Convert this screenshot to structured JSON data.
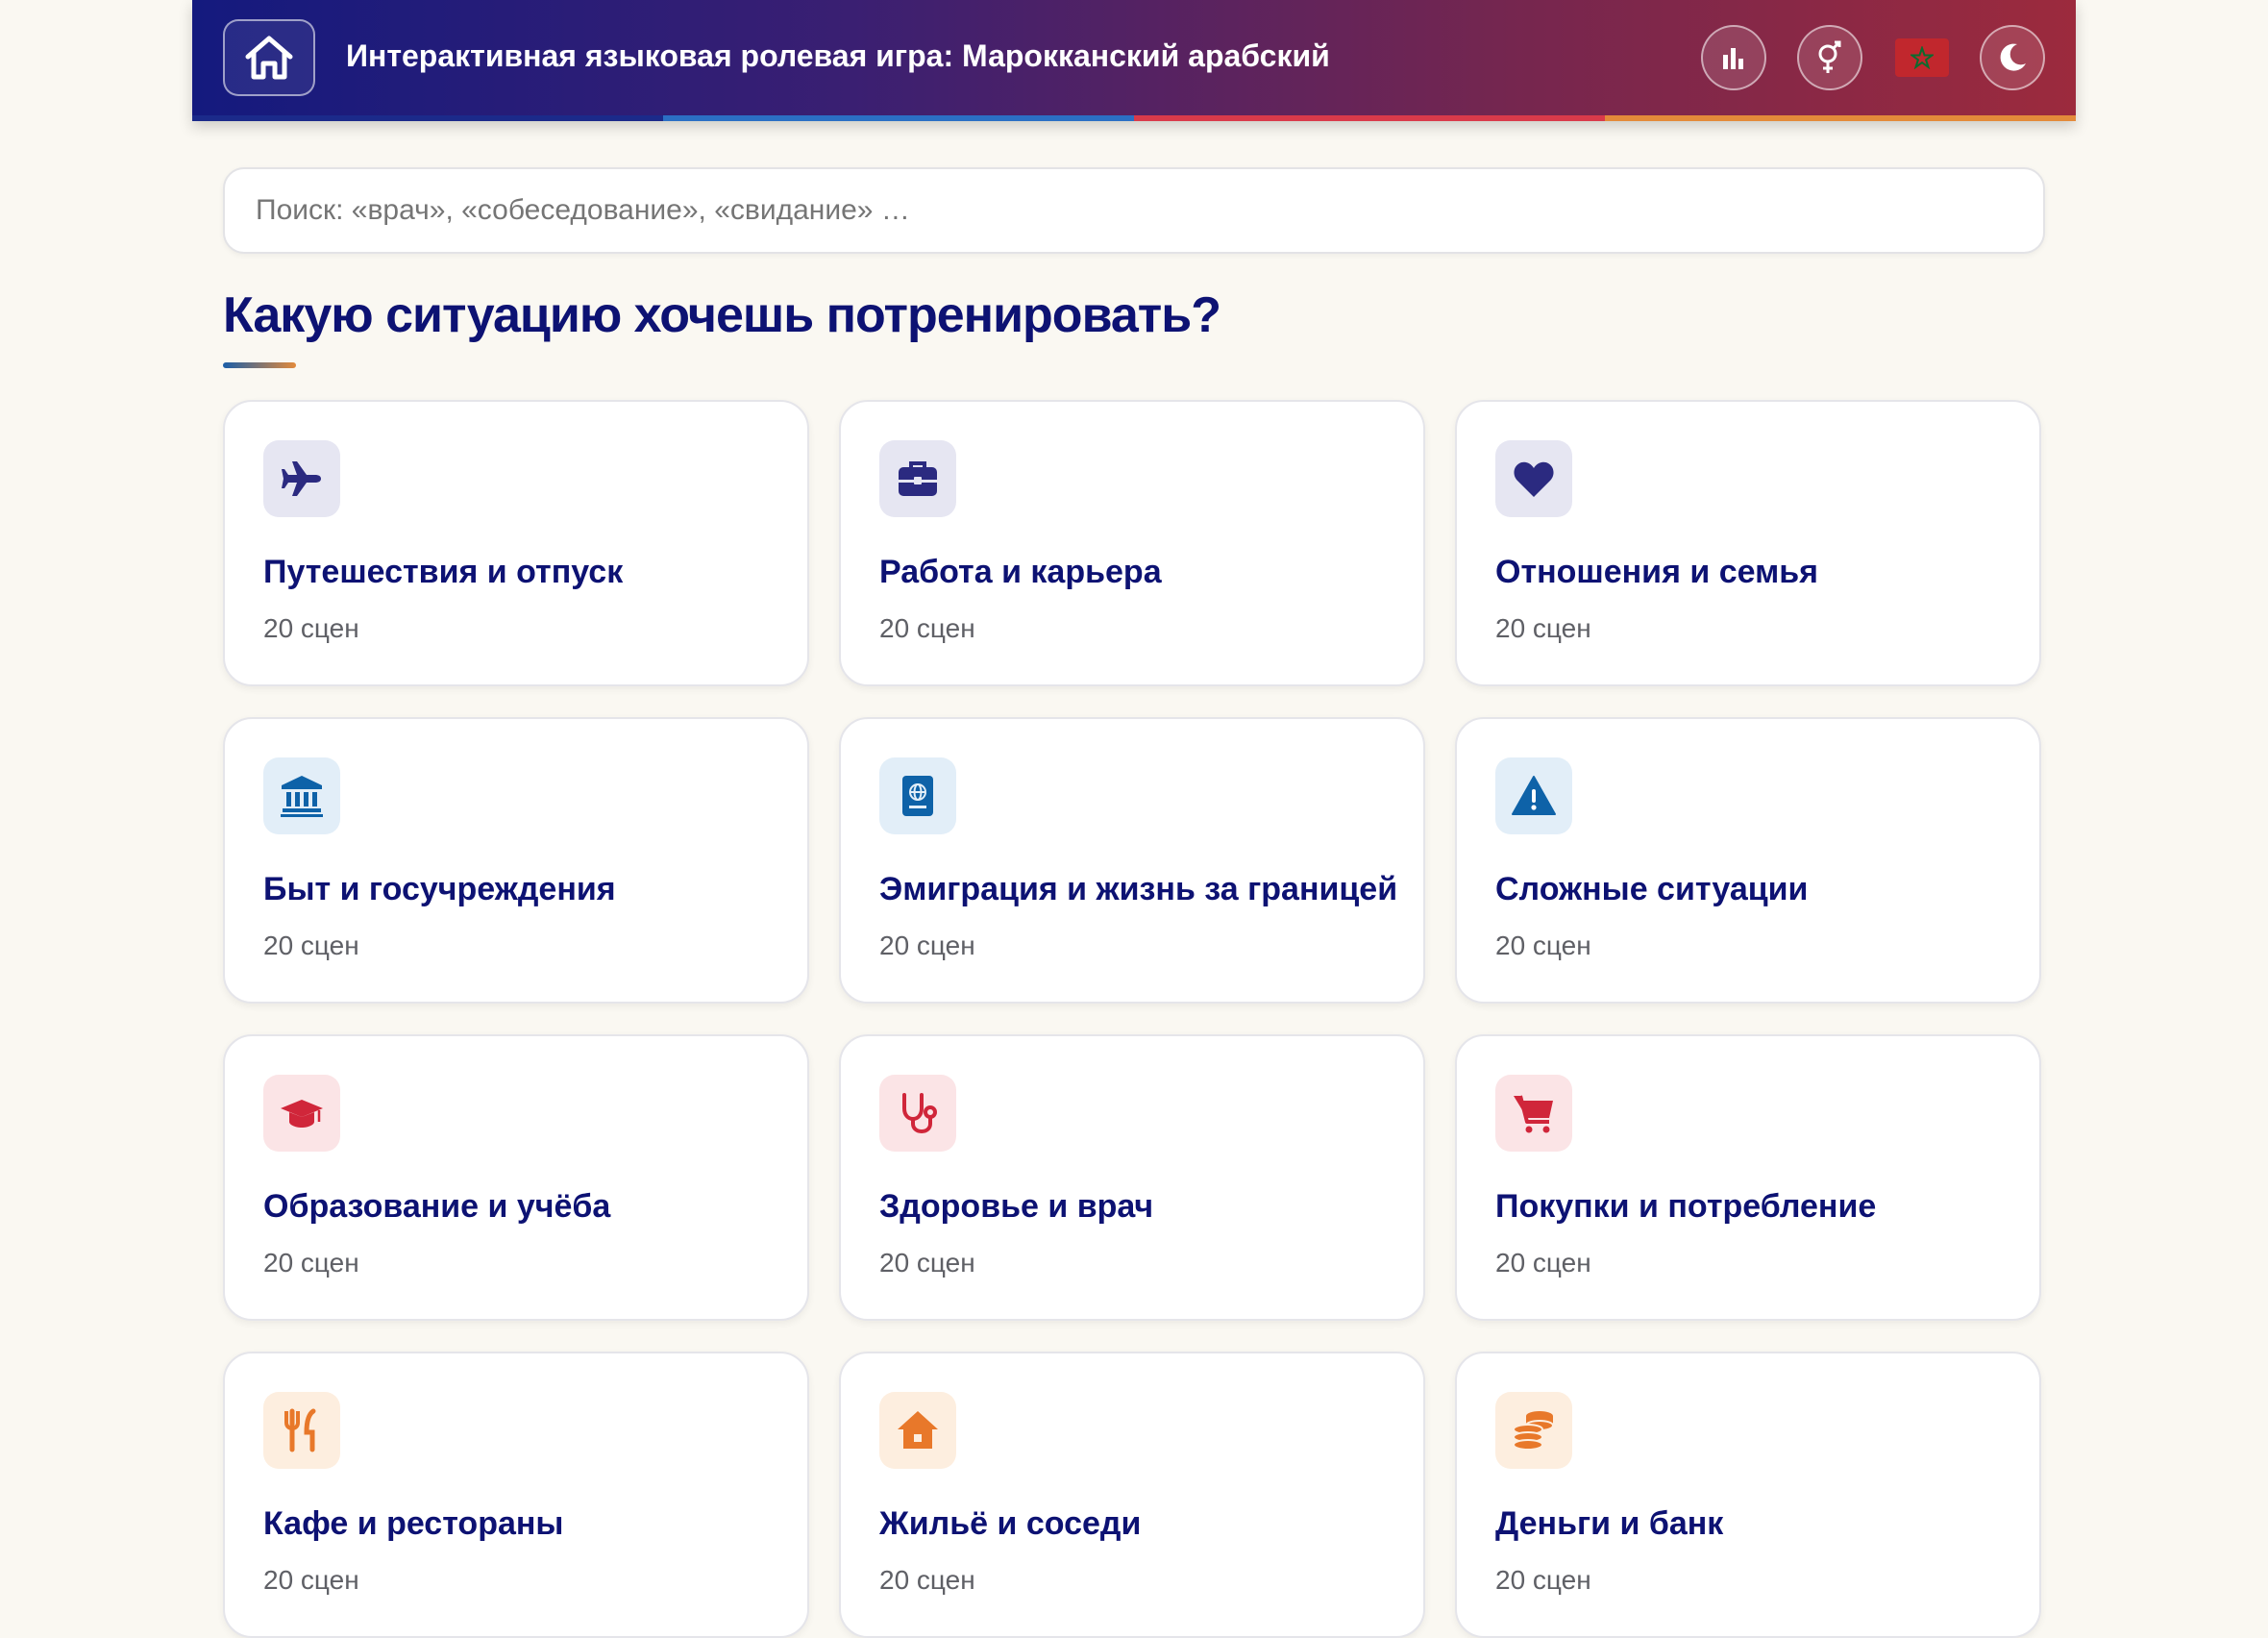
{
  "header": {
    "title": "Интерактивная языковая ролевая игра: Марокканский арабский",
    "home_icon": "home-icon",
    "icons": [
      "stats-icon",
      "gender-icon",
      "morocco-flag-icon",
      "moon-icon"
    ],
    "stripe_colors": [
      "#1b2a8a",
      "#2b6fc4",
      "#d93a4a",
      "#e38a3a"
    ]
  },
  "search": {
    "placeholder": "Поиск: «врач», «собеседование», «свидание» …"
  },
  "main": {
    "heading": "Какую ситуацию хочешь потренировать?",
    "categories": [
      {
        "label": "Путешествия и отпуск",
        "count": "20 сцен",
        "icon": "plane-icon",
        "color": "#2b2a80",
        "bg": "#e6e6f2"
      },
      {
        "label": "Работа и карьера",
        "count": "20 сцен",
        "icon": "briefcase-icon",
        "color": "#2b2a80",
        "bg": "#e6e6f2"
      },
      {
        "label": "Отношения и семья",
        "count": "20 сцен",
        "icon": "heart-icon",
        "color": "#2b2a80",
        "bg": "#e6e6f2"
      },
      {
        "label": "Быт и госучреждения",
        "count": "20 сцен",
        "icon": "bank-icon",
        "color": "#0e62a8",
        "bg": "#e2eef8"
      },
      {
        "label": "Эмиграция и жизнь за границей",
        "count": "20 сцен",
        "icon": "passport-icon",
        "color": "#0e62a8",
        "bg": "#e2eef8"
      },
      {
        "label": "Сложные ситуации",
        "count": "20 сцен",
        "icon": "warning-icon",
        "color": "#0e62a8",
        "bg": "#e2eef8"
      },
      {
        "label": "Образование и учёба",
        "count": "20 сцен",
        "icon": "graduation-cap-icon",
        "color": "#d0263a",
        "bg": "#fbe4e6"
      },
      {
        "label": "Здоровье и врач",
        "count": "20 сцен",
        "icon": "stethoscope-icon",
        "color": "#d0263a",
        "bg": "#fbe4e6"
      },
      {
        "label": "Покупки и потребление",
        "count": "20 сцен",
        "icon": "cart-icon",
        "color": "#d0263a",
        "bg": "#fbe4e6"
      },
      {
        "label": "Кафе и рестораны",
        "count": "20 сцен",
        "icon": "utensils-icon",
        "color": "#e8782a",
        "bg": "#fdeedf"
      },
      {
        "label": "Жильё и соседи",
        "count": "20 сцен",
        "icon": "house-icon",
        "color": "#e8782a",
        "bg": "#fdeedf"
      },
      {
        "label": "Деньги и банк",
        "count": "20 сцен",
        "icon": "coins-icon",
        "color": "#e8782a",
        "bg": "#fdeedf"
      }
    ]
  }
}
